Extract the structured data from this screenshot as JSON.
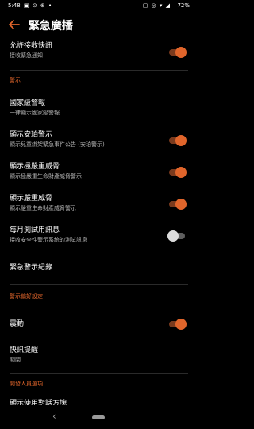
{
  "status_bar": {
    "time": "5:48",
    "left_icons": "▣ ⊙ ⊕ •",
    "right_icons": "▢ ◎ ▾ ◢",
    "battery": "72%"
  },
  "app_bar": {
    "title": "緊急廣播"
  },
  "settings": {
    "allow_alerts": {
      "title": "允許接收快訊",
      "subtitle": "接收緊急通知",
      "enabled": true
    },
    "alerts_header": "警示",
    "presidential": {
      "title": "國家級警報",
      "subtitle": "一律顯示國家級警報"
    },
    "amber": {
      "title": "顯示安珀警示",
      "subtitle": "顯示兒童綁架緊急事件公告 (安珀警示)",
      "enabled": true
    },
    "extreme": {
      "title": "顯示極嚴重威脅",
      "subtitle": "顯示極嚴重生命財產威脅警示",
      "enabled": true
    },
    "severe": {
      "title": "顯示嚴重威脅",
      "subtitle": "顯示嚴重生命財產威脅警示",
      "enabled": true
    },
    "monthly_test": {
      "title": "每月測試用訊息",
      "subtitle": "接收安全性警示系統的測試訊息",
      "enabled": false
    },
    "history": {
      "title": "緊急警示紀錄"
    },
    "preferences_header": "警示偏好設定",
    "vibrate": {
      "title": "震動",
      "enabled": true
    },
    "reminder": {
      "title": "快訊提醒",
      "subtitle": "關閉"
    },
    "developer_header": "開發人員選項",
    "partial_row": {
      "title": "顯示使用對話方塊"
    }
  },
  "nav_bar": {
    "back_glyph": "‹"
  },
  "colors": {
    "accent": "#e0652b",
    "background": "#000000"
  }
}
